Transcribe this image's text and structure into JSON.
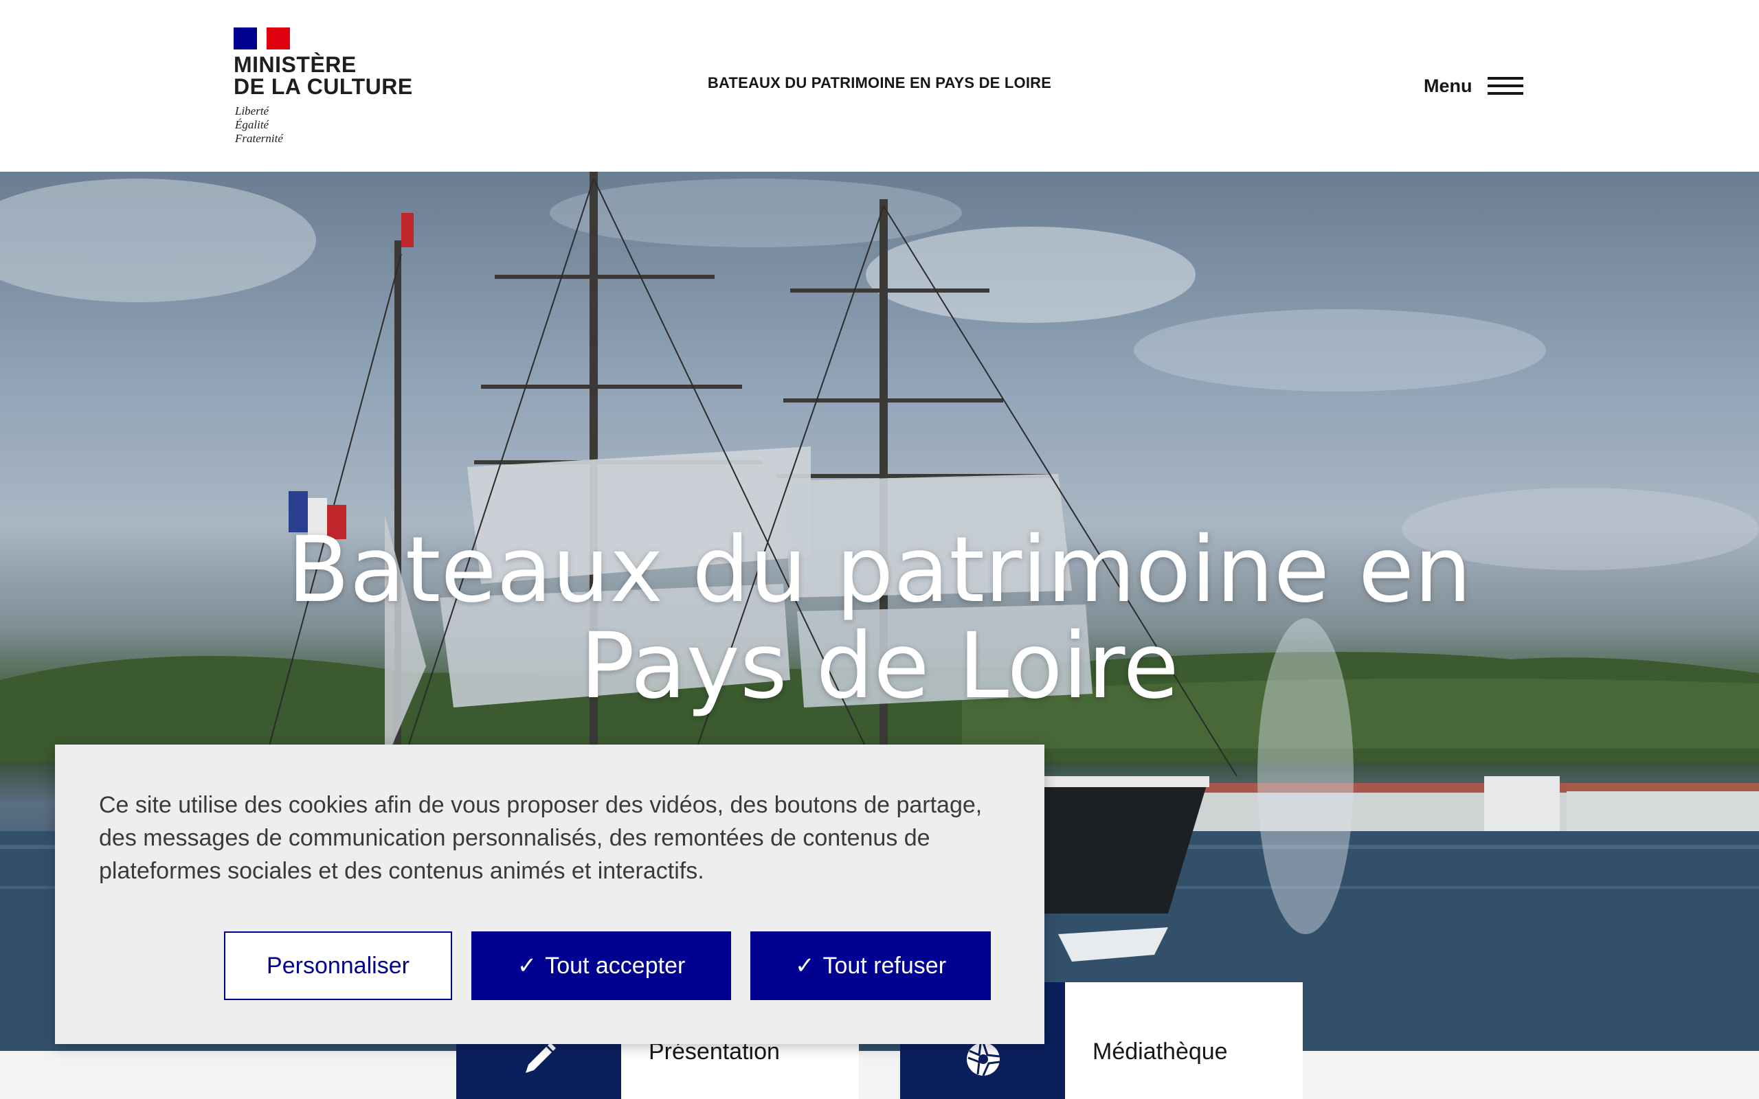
{
  "header": {
    "logo": {
      "title_line1": "MINISTÈRE",
      "title_line2": "DE LA CULTURE",
      "motto_line1": "Liberté",
      "motto_line2": "Égalité",
      "motto_line3": "Fraternité"
    },
    "site_name": "BATEAUX DU PATRIMOINE EN PAYS DE LOIRE",
    "menu_label": "Menu",
    "menu_icon": "hamburger-icon"
  },
  "hero": {
    "title_line1": "Bateaux du patrimoine en",
    "title_line2": "Pays de Loire"
  },
  "cookie_banner": {
    "text": "Ce site utilise des cookies afin de vous proposer des vidéos, des boutons de partage, des messages de communication personnalisés, des remontées de contenus de plateformes sociales et des contenus animés et interactifs.",
    "personalize_label": "Personnaliser",
    "accept_label": "Tout accepter",
    "refuse_label": "Tout refuser",
    "check_glyph": "✓"
  },
  "tiles": [
    {
      "label": "Présentation",
      "icon": "pencil-icon"
    },
    {
      "label": "Médiathèque",
      "icon": "camera-aperture-icon"
    }
  ],
  "colors": {
    "brand_blue": "#000091",
    "navy_tile": "#0a1f5c",
    "marianne_red": "#e1000f"
  }
}
